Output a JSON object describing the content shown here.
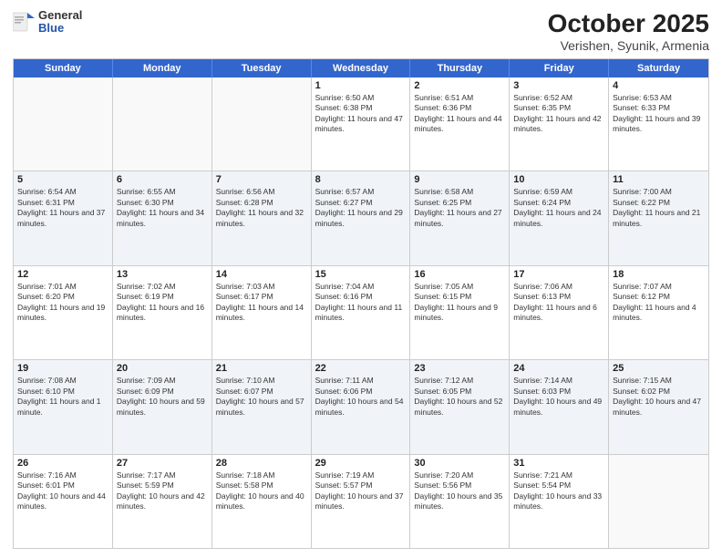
{
  "header": {
    "logo_general": "General",
    "logo_blue": "Blue",
    "month_title": "October 2025",
    "location": "Verishen, Syunik, Armenia"
  },
  "weekdays": [
    "Sunday",
    "Monday",
    "Tuesday",
    "Wednesday",
    "Thursday",
    "Friday",
    "Saturday"
  ],
  "rows": [
    [
      {
        "day": "",
        "text": ""
      },
      {
        "day": "",
        "text": ""
      },
      {
        "day": "",
        "text": ""
      },
      {
        "day": "1",
        "text": "Sunrise: 6:50 AM\nSunset: 6:38 PM\nDaylight: 11 hours and 47 minutes."
      },
      {
        "day": "2",
        "text": "Sunrise: 6:51 AM\nSunset: 6:36 PM\nDaylight: 11 hours and 44 minutes."
      },
      {
        "day": "3",
        "text": "Sunrise: 6:52 AM\nSunset: 6:35 PM\nDaylight: 11 hours and 42 minutes."
      },
      {
        "day": "4",
        "text": "Sunrise: 6:53 AM\nSunset: 6:33 PM\nDaylight: 11 hours and 39 minutes."
      }
    ],
    [
      {
        "day": "5",
        "text": "Sunrise: 6:54 AM\nSunset: 6:31 PM\nDaylight: 11 hours and 37 minutes."
      },
      {
        "day": "6",
        "text": "Sunrise: 6:55 AM\nSunset: 6:30 PM\nDaylight: 11 hours and 34 minutes."
      },
      {
        "day": "7",
        "text": "Sunrise: 6:56 AM\nSunset: 6:28 PM\nDaylight: 11 hours and 32 minutes."
      },
      {
        "day": "8",
        "text": "Sunrise: 6:57 AM\nSunset: 6:27 PM\nDaylight: 11 hours and 29 minutes."
      },
      {
        "day": "9",
        "text": "Sunrise: 6:58 AM\nSunset: 6:25 PM\nDaylight: 11 hours and 27 minutes."
      },
      {
        "day": "10",
        "text": "Sunrise: 6:59 AM\nSunset: 6:24 PM\nDaylight: 11 hours and 24 minutes."
      },
      {
        "day": "11",
        "text": "Sunrise: 7:00 AM\nSunset: 6:22 PM\nDaylight: 11 hours and 21 minutes."
      }
    ],
    [
      {
        "day": "12",
        "text": "Sunrise: 7:01 AM\nSunset: 6:20 PM\nDaylight: 11 hours and 19 minutes."
      },
      {
        "day": "13",
        "text": "Sunrise: 7:02 AM\nSunset: 6:19 PM\nDaylight: 11 hours and 16 minutes."
      },
      {
        "day": "14",
        "text": "Sunrise: 7:03 AM\nSunset: 6:17 PM\nDaylight: 11 hours and 14 minutes."
      },
      {
        "day": "15",
        "text": "Sunrise: 7:04 AM\nSunset: 6:16 PM\nDaylight: 11 hours and 11 minutes."
      },
      {
        "day": "16",
        "text": "Sunrise: 7:05 AM\nSunset: 6:15 PM\nDaylight: 11 hours and 9 minutes."
      },
      {
        "day": "17",
        "text": "Sunrise: 7:06 AM\nSunset: 6:13 PM\nDaylight: 11 hours and 6 minutes."
      },
      {
        "day": "18",
        "text": "Sunrise: 7:07 AM\nSunset: 6:12 PM\nDaylight: 11 hours and 4 minutes."
      }
    ],
    [
      {
        "day": "19",
        "text": "Sunrise: 7:08 AM\nSunset: 6:10 PM\nDaylight: 11 hours and 1 minute."
      },
      {
        "day": "20",
        "text": "Sunrise: 7:09 AM\nSunset: 6:09 PM\nDaylight: 10 hours and 59 minutes."
      },
      {
        "day": "21",
        "text": "Sunrise: 7:10 AM\nSunset: 6:07 PM\nDaylight: 10 hours and 57 minutes."
      },
      {
        "day": "22",
        "text": "Sunrise: 7:11 AM\nSunset: 6:06 PM\nDaylight: 10 hours and 54 minutes."
      },
      {
        "day": "23",
        "text": "Sunrise: 7:12 AM\nSunset: 6:05 PM\nDaylight: 10 hours and 52 minutes."
      },
      {
        "day": "24",
        "text": "Sunrise: 7:14 AM\nSunset: 6:03 PM\nDaylight: 10 hours and 49 minutes."
      },
      {
        "day": "25",
        "text": "Sunrise: 7:15 AM\nSunset: 6:02 PM\nDaylight: 10 hours and 47 minutes."
      }
    ],
    [
      {
        "day": "26",
        "text": "Sunrise: 7:16 AM\nSunset: 6:01 PM\nDaylight: 10 hours and 44 minutes."
      },
      {
        "day": "27",
        "text": "Sunrise: 7:17 AM\nSunset: 5:59 PM\nDaylight: 10 hours and 42 minutes."
      },
      {
        "day": "28",
        "text": "Sunrise: 7:18 AM\nSunset: 5:58 PM\nDaylight: 10 hours and 40 minutes."
      },
      {
        "day": "29",
        "text": "Sunrise: 7:19 AM\nSunset: 5:57 PM\nDaylight: 10 hours and 37 minutes."
      },
      {
        "day": "30",
        "text": "Sunrise: 7:20 AM\nSunset: 5:56 PM\nDaylight: 10 hours and 35 minutes."
      },
      {
        "day": "31",
        "text": "Sunrise: 7:21 AM\nSunset: 5:54 PM\nDaylight: 10 hours and 33 minutes."
      },
      {
        "day": "",
        "text": ""
      }
    ]
  ]
}
